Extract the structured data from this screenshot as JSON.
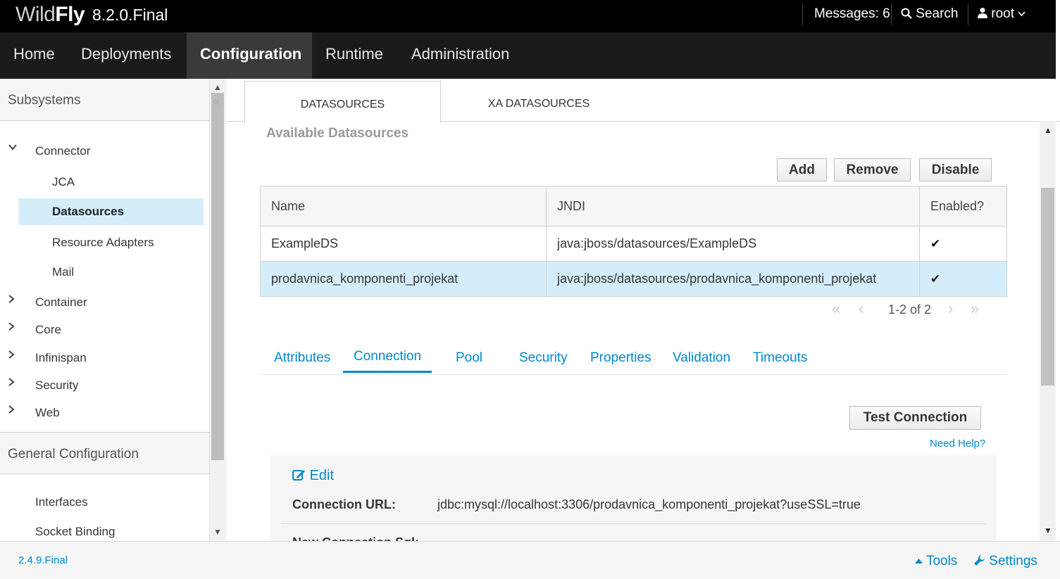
{
  "header": {
    "brand_wild": "Wild",
    "brand_fly": "Fly",
    "version": "8.2.0.Final",
    "messages": "Messages: 6",
    "search": "Search",
    "user": "root"
  },
  "nav": {
    "items": [
      "Home",
      "Deployments",
      "Configuration",
      "Runtime",
      "Administration"
    ],
    "active": "Configuration"
  },
  "sidebar": {
    "subsystems_header": "Subsystems",
    "connector": "Connector",
    "connector_children": [
      "JCA",
      "Datasources",
      "Resource Adapters",
      "Mail"
    ],
    "selected": "Datasources",
    "groups": [
      "Container",
      "Core",
      "Infinispan",
      "Security",
      "Web"
    ],
    "general_header": "General Configuration",
    "general_items": [
      "Interfaces",
      "Socket Binding"
    ]
  },
  "main": {
    "tabs": [
      "DATASOURCES",
      "XA DATASOURCES"
    ],
    "active_tab": "DATASOURCES",
    "section_title": "Available Datasources",
    "buttons": {
      "add": "Add",
      "remove": "Remove",
      "disable": "Disable"
    },
    "table": {
      "columns": [
        "Name",
        "JNDI",
        "Enabled?"
      ],
      "rows": [
        {
          "name": "ExampleDS",
          "jndi": "java:jboss/datasources/ExampleDS",
          "enabled": "✔"
        },
        {
          "name": "prodavnica_komponenti_projekat",
          "jndi": "java:jboss/datasources/prodavnica_komponenti_projekat",
          "enabled": "✔"
        }
      ],
      "selected_row": 1
    },
    "pager": "1-2 of 2",
    "subtabs": [
      "Attributes",
      "Connection",
      "Pool",
      "Security",
      "Properties",
      "Validation",
      "Timeouts"
    ],
    "active_subtab": "Connection",
    "test_connection": "Test Connection",
    "need_help": "Need Help?",
    "edit": "Edit",
    "connection_url_label": "Connection URL:",
    "connection_url_value": "jdbc:mysql://localhost:3306/prodavnica_komponenti_projekat?useSSL=true",
    "partial_label": "New Connection Sql:"
  },
  "footer": {
    "version": "2.4.9.Final",
    "tools": "Tools",
    "settings": "Settings"
  },
  "colors": {
    "accent": "#0088ce",
    "selected_bg": "#d4edfa",
    "topbar": "#000000",
    "navbar": "#1b1b1b"
  }
}
